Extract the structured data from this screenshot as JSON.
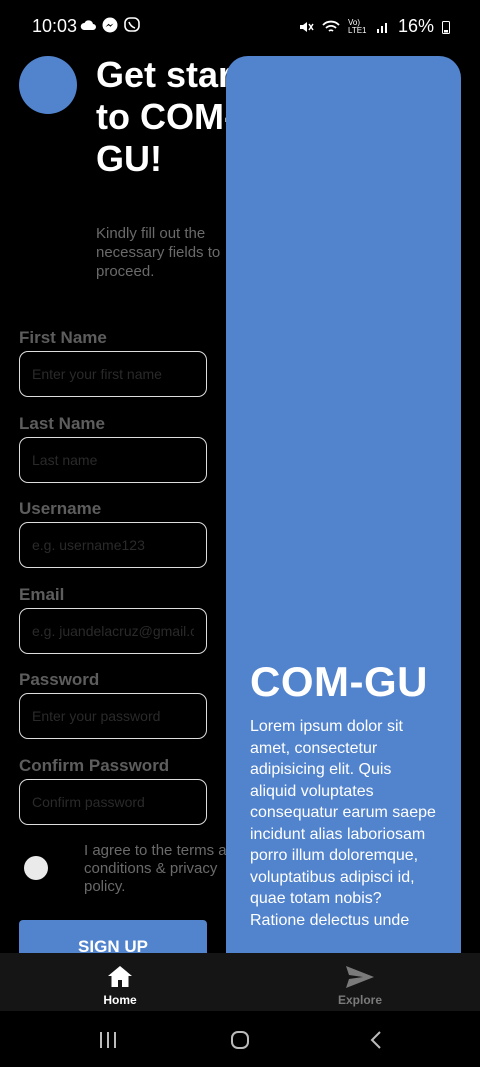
{
  "status_bar": {
    "time": "10:03",
    "battery": "16%",
    "network": "Vo) LTE1"
  },
  "header": {
    "title": "Get started to COM-GU!",
    "subtitle": "Kindly fill out the necessary fields to proceed."
  },
  "form": {
    "fields": [
      {
        "label": "First Name",
        "placeholder": "Enter your first name"
      },
      {
        "label": "Last Name",
        "placeholder": "Last name"
      },
      {
        "label": "Username",
        "placeholder": "e.g. username123"
      },
      {
        "label": "Email",
        "placeholder": "e.g. juandelacruz@gmail.com"
      },
      {
        "label": "Password",
        "placeholder": "Enter your password"
      },
      {
        "label": "Confirm Password",
        "placeholder": "Confirm password"
      }
    ],
    "agree_text": "I agree to the terms and conditions & privacy policy.",
    "signup_label": "SIGN UP"
  },
  "overlay": {
    "title": "COM-GU",
    "body": "Lorem ipsum dolor sit amet, consectetur adipisicing elit. Quis aliquid voluptates consequatur earum saepe incidunt alias laboriosam porro illum doloremque, voluptatibus adipisci id, quae totam nobis? Ratione delectus unde"
  },
  "bottom_nav": {
    "items": [
      {
        "label": "Home",
        "icon": "home-icon",
        "active": true
      },
      {
        "label": "Explore",
        "icon": "send-icon",
        "active": false
      }
    ]
  },
  "colors": {
    "accent": "#5283cd",
    "background": "#000000",
    "muted_text": "#6a6a6a",
    "nav_background": "#151515"
  }
}
